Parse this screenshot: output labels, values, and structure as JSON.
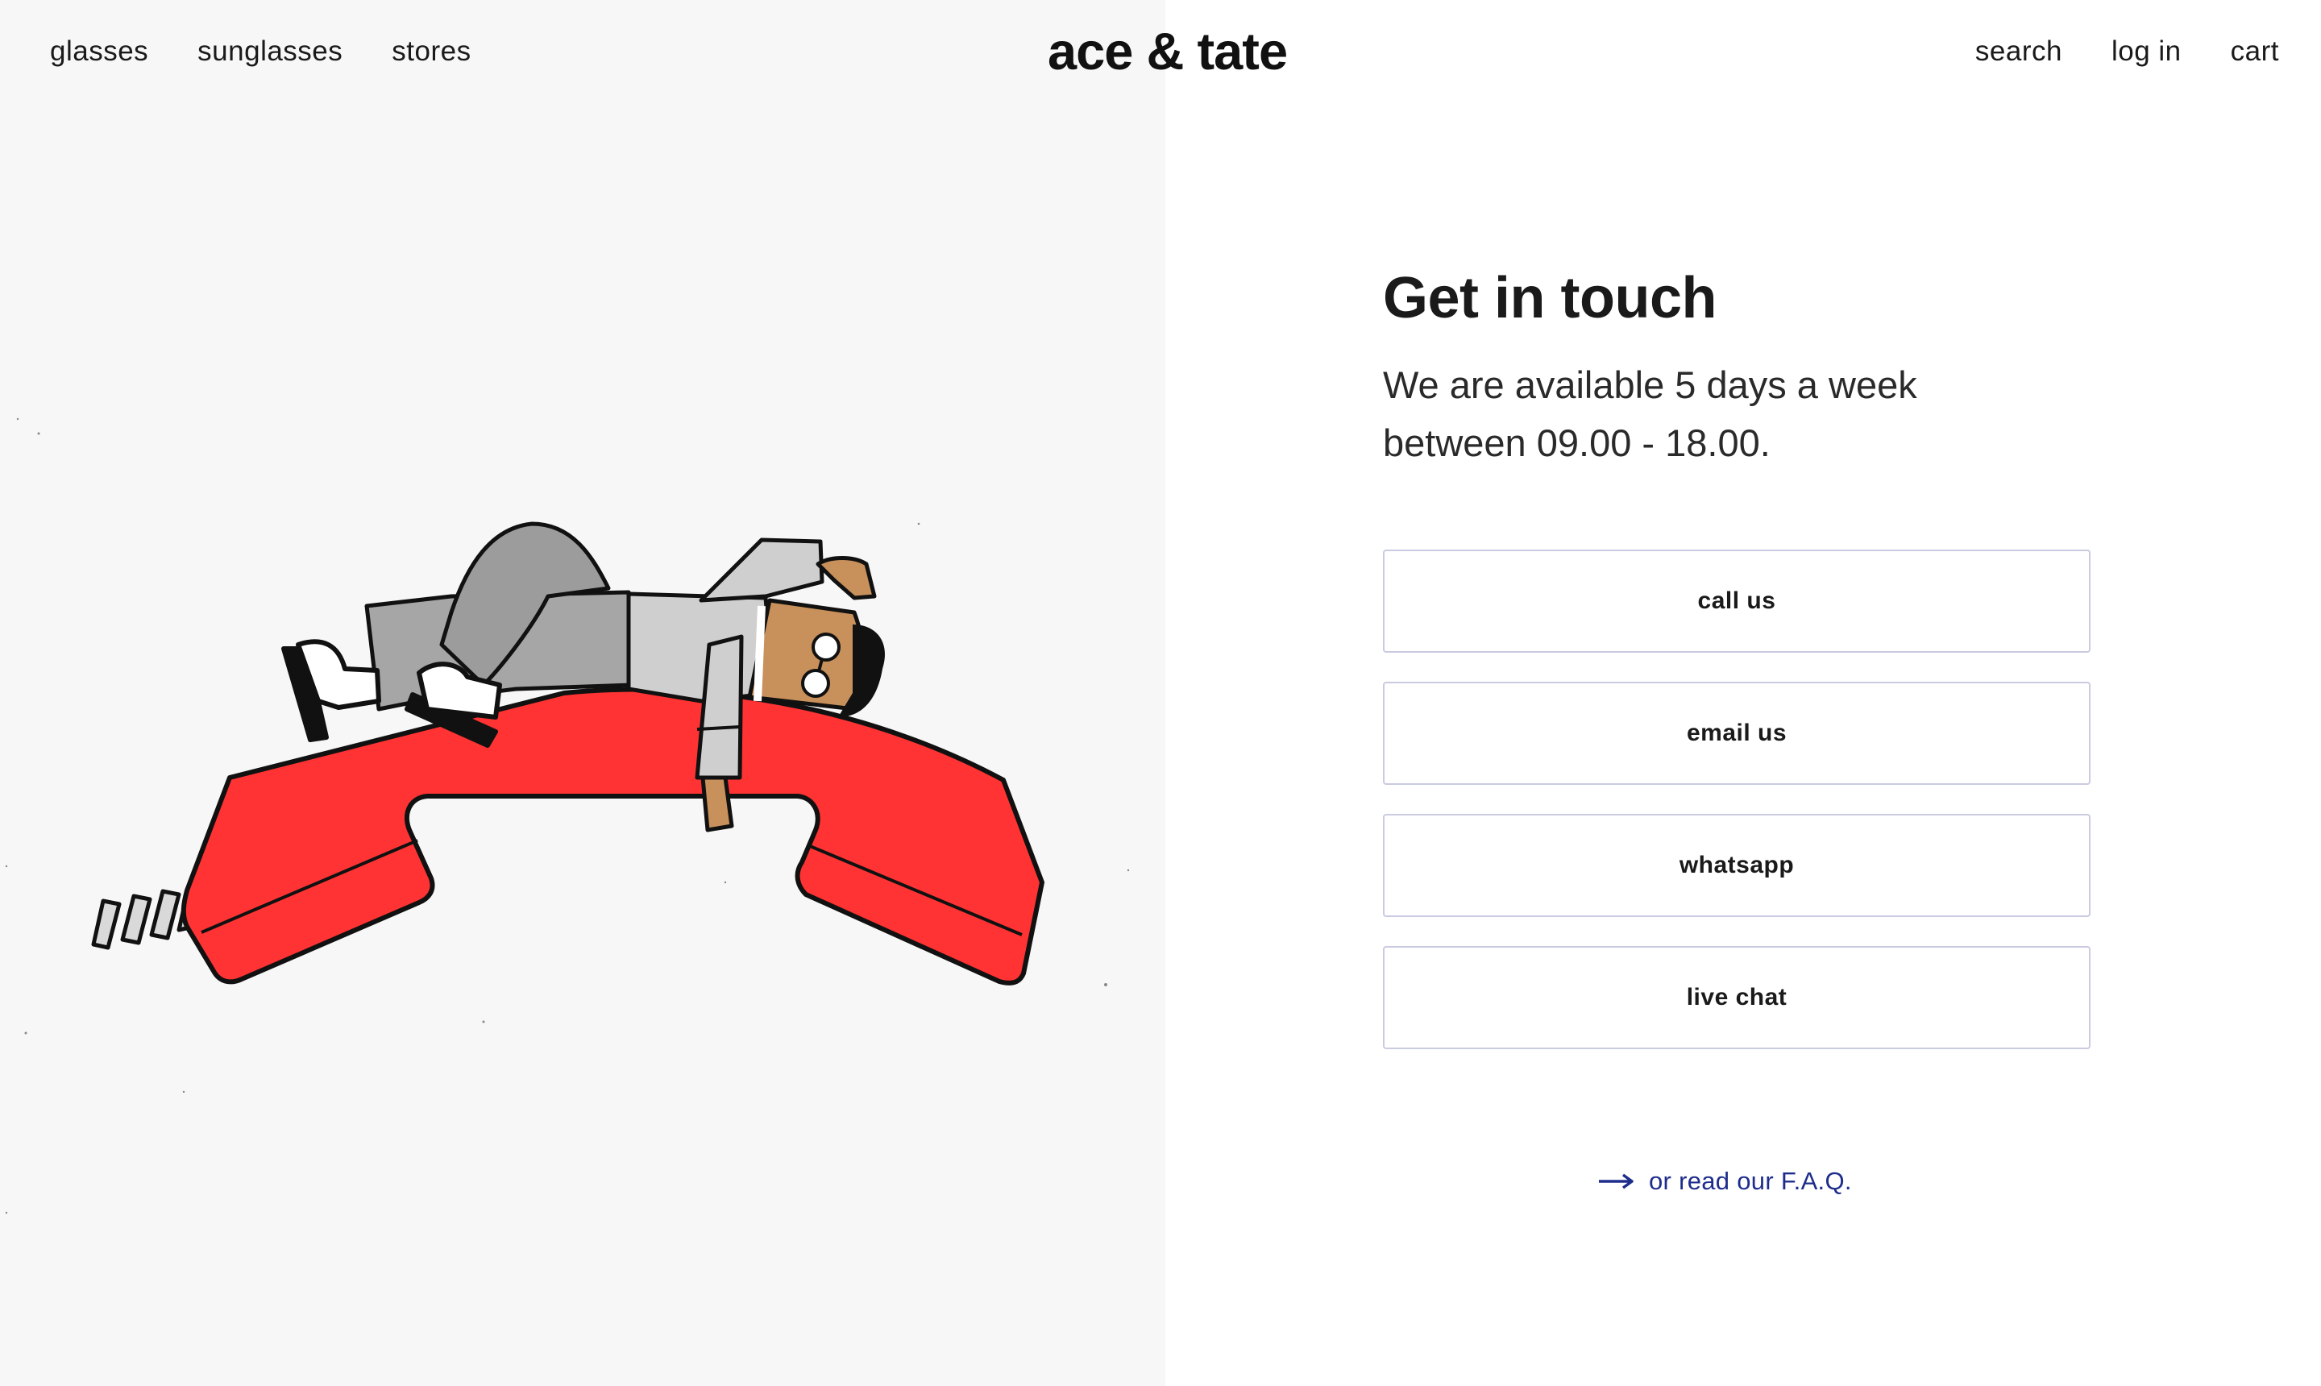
{
  "header": {
    "logo": "ace & tate",
    "nav_left": [
      "glasses",
      "sunglasses",
      "stores"
    ],
    "nav_right": [
      "search",
      "log in",
      "cart"
    ]
  },
  "main": {
    "title": "Get in touch",
    "availability_line1": "We are available 5 days a week",
    "availability_line2": "between 09.00 - 18.00.",
    "buttons": [
      "call us",
      "email us",
      "whatsapp",
      "live chat"
    ],
    "faq_link": "or read our F.A.Q."
  },
  "colors": {
    "left_background": "#f7f7f7",
    "phone_red": "#ff3333",
    "link_blue": "#1e2d8c",
    "button_border": "#c9cbe0"
  },
  "icons": {
    "faq_arrow": "arrow-right-icon"
  }
}
